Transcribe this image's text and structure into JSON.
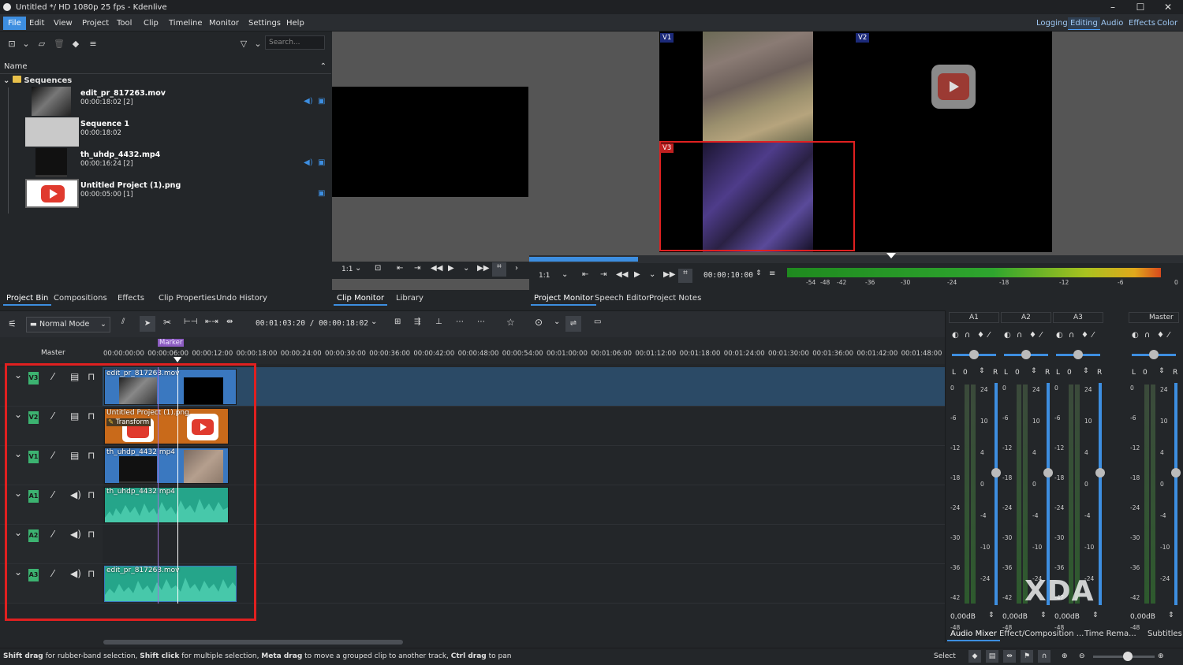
{
  "window": {
    "title": "Untitled */ HD 1080p 25 fps - Kdenlive",
    "minimize": "–",
    "maximize": "☐",
    "close": "✕"
  },
  "menu": {
    "items": [
      "File",
      "Edit",
      "View",
      "Project",
      "Tool",
      "Clip",
      "Timeline",
      "Monitor",
      "Settings",
      "Help"
    ],
    "active": "File"
  },
  "workspaces": {
    "items": [
      "Logging",
      "Editing",
      "Audio",
      "Effects",
      "Color"
    ],
    "active": "Editing"
  },
  "bin": {
    "search_placeholder": "Search...",
    "column_name": "Name",
    "folder": "Sequences",
    "clips": [
      {
        "name": "edit_pr_817263.mov",
        "duration": "00:00:18:02 [2]"
      },
      {
        "name": "Sequence 1",
        "duration": "00:00:18:02"
      },
      {
        "name": "th_uhdp_4432.mp4",
        "duration": "00:00:16:24 [2]"
      },
      {
        "name": "Untitled Project (1).png",
        "duration": "00:00:05:00 [1]"
      }
    ],
    "tabs": [
      "Project Bin",
      "Compositions",
      "Effects",
      "Clip Properties",
      "Undo History"
    ]
  },
  "clip_monitor": {
    "zoom": "1:1",
    "tabs": [
      "Clip Monitor",
      "Library"
    ]
  },
  "project_monitor": {
    "zoom": "1:1",
    "timecode": "00:00:10:00",
    "overlays": [
      "V1",
      "V2",
      "V3"
    ],
    "meter_scale": [
      "-54",
      "-48",
      "-42",
      "-36",
      "-30",
      "-24",
      "-18",
      "-12",
      "-6",
      "0"
    ],
    "tabs": [
      "Project Monitor",
      "Speech Editor",
      "Project Notes"
    ]
  },
  "timeline_toolbar": {
    "mode": "Normal Mode",
    "timecode": "00:01:03:20 / 00:00:18:02"
  },
  "timeline": {
    "master_label": "Master",
    "marker_label": "Marker",
    "ruler": [
      "00:00:00:00",
      "00:00:06:00",
      "00:00:12:00",
      "00:00:18:00",
      "00:00:24:00",
      "00:00:30:00",
      "00:00:36:00",
      "00:00:42:00",
      "00:00:48:00",
      "00:00:54:00",
      "00:01:00:00",
      "00:01:06:00",
      "00:01:12:00",
      "00:01:18:00",
      "00:01:24:00",
      "00:01:30:00",
      "00:01:36:00",
      "00:01:42:00",
      "00:01:48:00"
    ],
    "tracks": [
      {
        "id": "V3",
        "clip": "edit_pr_817263.mov"
      },
      {
        "id": "V2",
        "clip": "Untitled Project (1).png",
        "effect": "Transform"
      },
      {
        "id": "V1",
        "clip": "th_uhdp_4432.mp4"
      },
      {
        "id": "A1",
        "clip": "th_uhdp_4432.mp4"
      },
      {
        "id": "A2",
        "clip": ""
      },
      {
        "id": "A3",
        "clip": "edit_pr_817263.mov"
      }
    ],
    "highlight_color": "#e02020"
  },
  "mixer": {
    "channels": [
      "A1",
      "A2",
      "A3"
    ],
    "master": "Master",
    "balance_left": "L",
    "balance_right": "R",
    "balance_value": "0",
    "gain": "0,00dB",
    "db_scale": [
      "0",
      "-6",
      "-12",
      "-18",
      "-24",
      "-30",
      "-36",
      "-42",
      "-48"
    ],
    "fader_scale": [
      "24",
      "10",
      "4",
      "0",
      "-4",
      "-10",
      "-24"
    ],
    "tabs": [
      "Audio Mixer",
      "Effect/Composition ...",
      "Time Rema...",
      "Subtitles"
    ],
    "watermark": "XDA"
  },
  "statusbar": {
    "hint_parts": [
      {
        "b": "Shift drag",
        "t": " for rubber-band selection, "
      },
      {
        "b": "Shift click",
        "t": " for multiple selection, "
      },
      {
        "b": "Meta drag",
        "t": " to move a grouped clip to another track, "
      },
      {
        "b": "Ctrl drag",
        "t": " to pan"
      }
    ],
    "tool": "Select"
  }
}
